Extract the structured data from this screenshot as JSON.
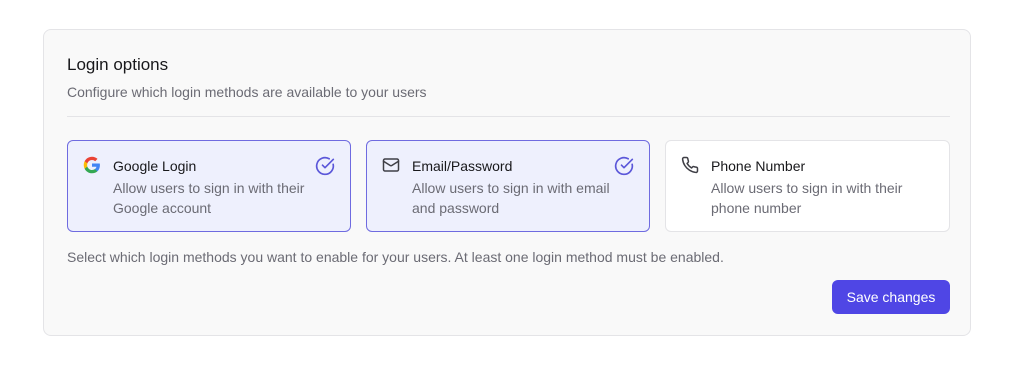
{
  "section": {
    "title": "Login options",
    "subtitle": "Configure which login methods are available to your users"
  },
  "options": [
    {
      "title": "Google Login",
      "description": "Allow users to sign in with their Google account",
      "icon": "google-icon",
      "selected": true
    },
    {
      "title": "Email/Password",
      "description": "Allow users to sign in with email and password",
      "icon": "mail-icon",
      "selected": true
    },
    {
      "title": "Phone Number",
      "description": "Allow users to sign in with their phone number",
      "icon": "phone-icon",
      "selected": false
    }
  ],
  "helper_text": "Select which login methods you want to enable for your users. At least one login method must be enabled.",
  "actions": {
    "save_label": "Save changes"
  },
  "colors": {
    "accent": "#4f46e5",
    "selected_bg": "#eef0fd",
    "selected_border": "#6f6be0",
    "check": "#5b57d9"
  }
}
